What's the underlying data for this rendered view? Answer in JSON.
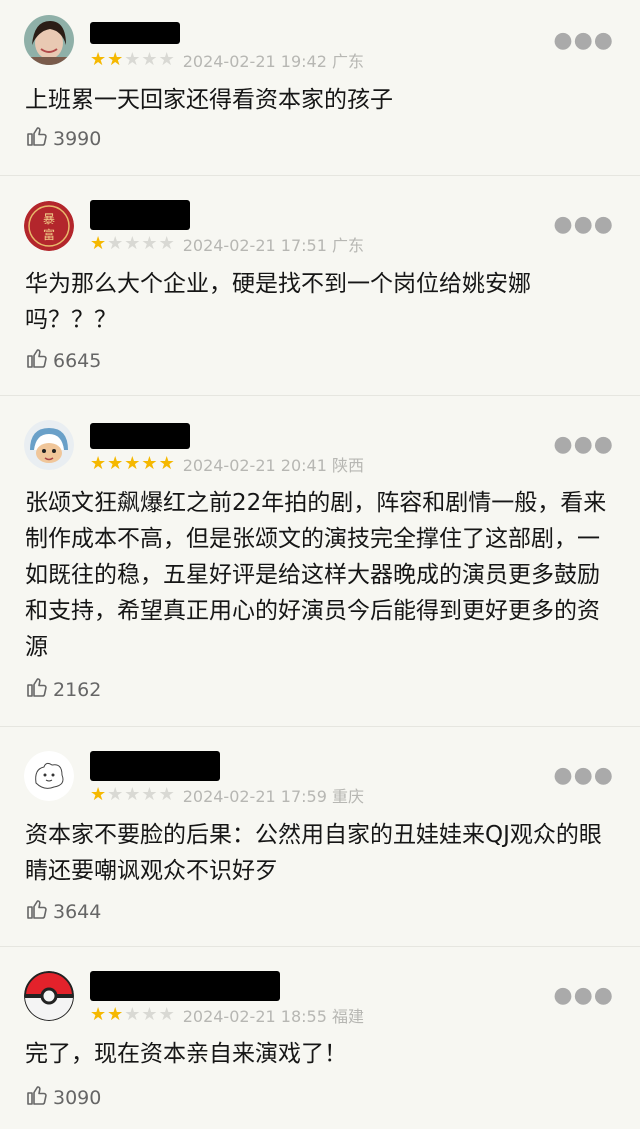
{
  "comments": [
    {
      "rating": 2,
      "datetime": "2024-02-21 19:42",
      "location": "广东",
      "text": "上班累一天回家还得看资本家的孩子",
      "likes": "3990",
      "avatar": "photo"
    },
    {
      "rating": 1,
      "datetime": "2024-02-21 17:51",
      "location": "广东",
      "text": "华为那么大个企业，硬是找不到一个岗位给姚安娜吗？？？",
      "likes": "6645",
      "avatar": "red-seal",
      "avatar_text": [
        "暴",
        "富"
      ]
    },
    {
      "rating": 5,
      "datetime": "2024-02-21 20:41",
      "location": "陕西",
      "text": "张颂文狂飙爆红之前22年拍的剧，阵容和剧情一般，看来制作成本不高，但是张颂文的演技完全撑住了这部剧，一如既往的稳，五星好评是给这样大器晚成的演员更多鼓励和支持，希望真正用心的好演员今后能得到更好更多的资源",
      "likes": "2162",
      "avatar": "cartoon-helmet"
    },
    {
      "rating": 1,
      "datetime": "2024-02-21 17:59",
      "location": "重庆",
      "text": "资本家不要脸的后果：公然用自家的丑娃娃来QJ观众的眼睛还要嘲讽观众不识好歹",
      "likes": "3644",
      "avatar": "sketch-cat"
    },
    {
      "rating": 2,
      "datetime": "2024-02-21 18:55",
      "location": "福建",
      "text": "完了，现在资本亲自来演戏了！",
      "likes": "3090",
      "avatar": "pokeball"
    }
  ],
  "colors": {
    "star_on": "#f5b800",
    "star_off": "#d9d9d4",
    "meta": "#b7b7b3"
  },
  "icons": {
    "like": "thumbs-up-icon",
    "more": "more-dots-icon",
    "star": "star-icon"
  }
}
